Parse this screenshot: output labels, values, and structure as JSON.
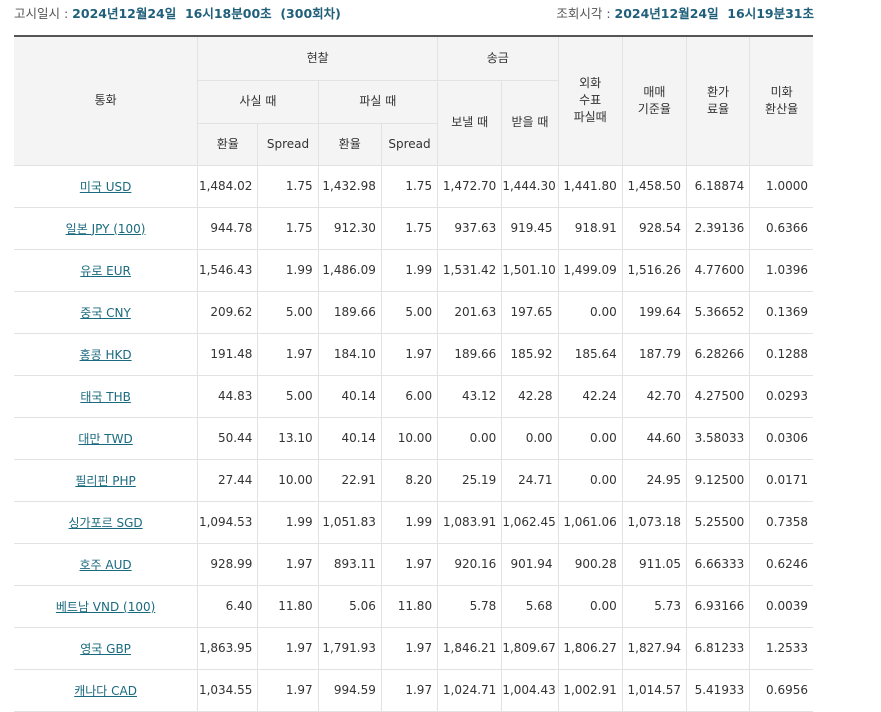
{
  "header": {
    "notice_label": "고시일시 :",
    "notice_value": "2024년12월24일  16시18분00초  (300회차)",
    "lookup_label": "조회시각 :",
    "lookup_value": "2024년12월24일  16시19분31초"
  },
  "columns": {
    "currency": "통화",
    "cash": "현찰",
    "remit": "송금",
    "fx_check": "외화\n수표\n파실때",
    "base_rate": "매매\n기준율",
    "conv_rate": "환가\n료율",
    "usd_conv": "미화\n환산율",
    "buy": "사실 때",
    "sell": "파실 때",
    "send": "보낼 때",
    "receive": "받을 때",
    "rate": "환율",
    "spread": "Spread"
  },
  "rows": [
    {
      "currency": "미국 USD",
      "cash_buy": "1,484.02",
      "cash_buy_spread": "1.75",
      "cash_sell": "1,432.98",
      "cash_sell_spread": "1.75",
      "send": "1,472.70",
      "receive": "1,444.30",
      "fx_check": "1,441.80",
      "base": "1,458.50",
      "conv": "6.18874",
      "usd": "1.0000"
    },
    {
      "currency": "일본 JPY (100)",
      "cash_buy": "944.78",
      "cash_buy_spread": "1.75",
      "cash_sell": "912.30",
      "cash_sell_spread": "1.75",
      "send": "937.63",
      "receive": "919.45",
      "fx_check": "918.91",
      "base": "928.54",
      "conv": "2.39136",
      "usd": "0.6366"
    },
    {
      "currency": "유로 EUR",
      "cash_buy": "1,546.43",
      "cash_buy_spread": "1.99",
      "cash_sell": "1,486.09",
      "cash_sell_spread": "1.99",
      "send": "1,531.42",
      "receive": "1,501.10",
      "fx_check": "1,499.09",
      "base": "1,516.26",
      "conv": "4.77600",
      "usd": "1.0396"
    },
    {
      "currency": "중국 CNY",
      "cash_buy": "209.62",
      "cash_buy_spread": "5.00",
      "cash_sell": "189.66",
      "cash_sell_spread": "5.00",
      "send": "201.63",
      "receive": "197.65",
      "fx_check": "0.00",
      "base": "199.64",
      "conv": "5.36652",
      "usd": "0.1369"
    },
    {
      "currency": "홍콩 HKD",
      "cash_buy": "191.48",
      "cash_buy_spread": "1.97",
      "cash_sell": "184.10",
      "cash_sell_spread": "1.97",
      "send": "189.66",
      "receive": "185.92",
      "fx_check": "185.64",
      "base": "187.79",
      "conv": "6.28266",
      "usd": "0.1288"
    },
    {
      "currency": "태국 THB",
      "cash_buy": "44.83",
      "cash_buy_spread": "5.00",
      "cash_sell": "40.14",
      "cash_sell_spread": "6.00",
      "send": "43.12",
      "receive": "42.28",
      "fx_check": "42.24",
      "base": "42.70",
      "conv": "4.27500",
      "usd": "0.0293"
    },
    {
      "currency": "대만 TWD",
      "cash_buy": "50.44",
      "cash_buy_spread": "13.10",
      "cash_sell": "40.14",
      "cash_sell_spread": "10.00",
      "send": "0.00",
      "receive": "0.00",
      "fx_check": "0.00",
      "base": "44.60",
      "conv": "3.58033",
      "usd": "0.0306"
    },
    {
      "currency": "필리핀 PHP",
      "cash_buy": "27.44",
      "cash_buy_spread": "10.00",
      "cash_sell": "22.91",
      "cash_sell_spread": "8.20",
      "send": "25.19",
      "receive": "24.71",
      "fx_check": "0.00",
      "base": "24.95",
      "conv": "9.12500",
      "usd": "0.0171"
    },
    {
      "currency": "싱가포르 SGD",
      "cash_buy": "1,094.53",
      "cash_buy_spread": "1.99",
      "cash_sell": "1,051.83",
      "cash_sell_spread": "1.99",
      "send": "1,083.91",
      "receive": "1,062.45",
      "fx_check": "1,061.06",
      "base": "1,073.18",
      "conv": "5.25500",
      "usd": "0.7358"
    },
    {
      "currency": "호주 AUD",
      "cash_buy": "928.99",
      "cash_buy_spread": "1.97",
      "cash_sell": "893.11",
      "cash_sell_spread": "1.97",
      "send": "920.16",
      "receive": "901.94",
      "fx_check": "900.28",
      "base": "911.05",
      "conv": "6.66333",
      "usd": "0.6246"
    },
    {
      "currency": "베트남 VND (100)",
      "cash_buy": "6.40",
      "cash_buy_spread": "11.80",
      "cash_sell": "5.06",
      "cash_sell_spread": "11.80",
      "send": "5.78",
      "receive": "5.68",
      "fx_check": "0.00",
      "base": "5.73",
      "conv": "6.93166",
      "usd": "0.0039"
    },
    {
      "currency": "영국 GBP",
      "cash_buy": "1,863.95",
      "cash_buy_spread": "1.97",
      "cash_sell": "1,791.93",
      "cash_sell_spread": "1.97",
      "send": "1,846.21",
      "receive": "1,809.67",
      "fx_check": "1,806.27",
      "base": "1,827.94",
      "conv": "6.81233",
      "usd": "1.2533"
    },
    {
      "currency": "캐나다 CAD",
      "cash_buy": "1,034.55",
      "cash_buy_spread": "1.97",
      "cash_sell": "994.59",
      "cash_sell_spread": "1.97",
      "send": "1,024.71",
      "receive": "1,004.43",
      "fx_check": "1,002.91",
      "base": "1,014.57",
      "conv": "5.41933",
      "usd": "0.6956"
    }
  ],
  "colors": {
    "link": "#1a6a7f",
    "header_bg": "#f4f4f4",
    "date_value": "#1f5f7a"
  }
}
